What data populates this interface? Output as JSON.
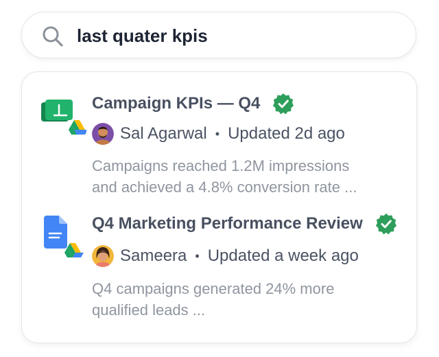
{
  "search": {
    "query": "last quater kpis",
    "icon": "search-icon"
  },
  "results": [
    {
      "file_type_icon": "google-sheets-icon",
      "source_icon": "google-drive-icon",
      "title": "Campaign KPIs — Q4",
      "verified": true,
      "author": "Sal Agarwal",
      "separator": "•",
      "updated": "Updated 2d ago",
      "snippet_line1": "Campaigns reached 1.2M impressions",
      "snippet_line2": "and achieved a 4.8% conversion rate ..."
    },
    {
      "file_type_icon": "google-docs-icon",
      "source_icon": "google-drive-icon",
      "title": "Q4 Marketing Performance Review",
      "verified": true,
      "author": "Sameera",
      "separator": "•",
      "updated": "Updated a week ago",
      "snippet_line1": "Q4 campaigns generated 24% more",
      "snippet_line2": "qualified leads ..."
    }
  ],
  "colors": {
    "title": "#485060",
    "meta": "#4a5262",
    "snippet": "#8f959f",
    "verified_green": "#2e9e5b",
    "sheets_green": "#1ea362",
    "docs_blue": "#4285f4"
  }
}
